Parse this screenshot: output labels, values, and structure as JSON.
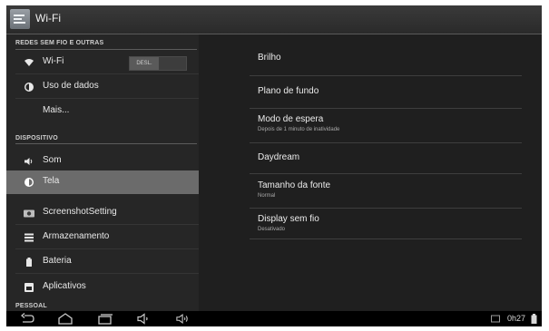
{
  "window": {
    "title": "Wi-Fi",
    "app_icon": "settings-app-icon"
  },
  "sidebar": {
    "sections": [
      {
        "header": "REDES SEM FIO E OUTRAS"
      },
      {
        "header": "DISPOSITIVO"
      },
      {
        "header": "PESSOAL"
      }
    ],
    "items": [
      {
        "label": "Wi-Fi",
        "icon": "wifi-icon",
        "toggle": "DESL."
      },
      {
        "label": "Uso de dados",
        "icon": "data-usage-icon"
      },
      {
        "label": "Mais...",
        "icon": ""
      },
      {
        "label": "Som",
        "icon": "speaker-icon"
      },
      {
        "label": "Tela",
        "icon": "brightness-icon",
        "selected": true
      },
      {
        "label": "ScreenshotSetting",
        "icon": "camera-icon"
      },
      {
        "label": "Armazenamento",
        "icon": "storage-icon"
      },
      {
        "label": "Bateria",
        "icon": "battery-icon"
      },
      {
        "label": "Aplicativos",
        "icon": "apps-icon"
      }
    ]
  },
  "content": {
    "rows": [
      {
        "title": "Brilho",
        "subtitle": ""
      },
      {
        "title": "Plano de fundo",
        "subtitle": ""
      },
      {
        "title": "Modo de espera",
        "subtitle": "Depois de 1 minuto de inatividade"
      },
      {
        "title": "Daydream",
        "subtitle": ""
      },
      {
        "title": "Tamanho da fonte",
        "subtitle": "Normal"
      },
      {
        "title": "Display sem fio",
        "subtitle": "Desativado"
      }
    ]
  },
  "navbar": {
    "icons": [
      "back-icon",
      "home-icon",
      "recent-apps-icon",
      "volume-down-icon",
      "volume-up-icon"
    ],
    "status_icons": [
      "notification-icon",
      "battery-status-icon"
    ],
    "time": "0h27"
  },
  "colors": {
    "background": "#1f1f1f",
    "selected": "#6b6b6b",
    "navbar": "#000000"
  }
}
